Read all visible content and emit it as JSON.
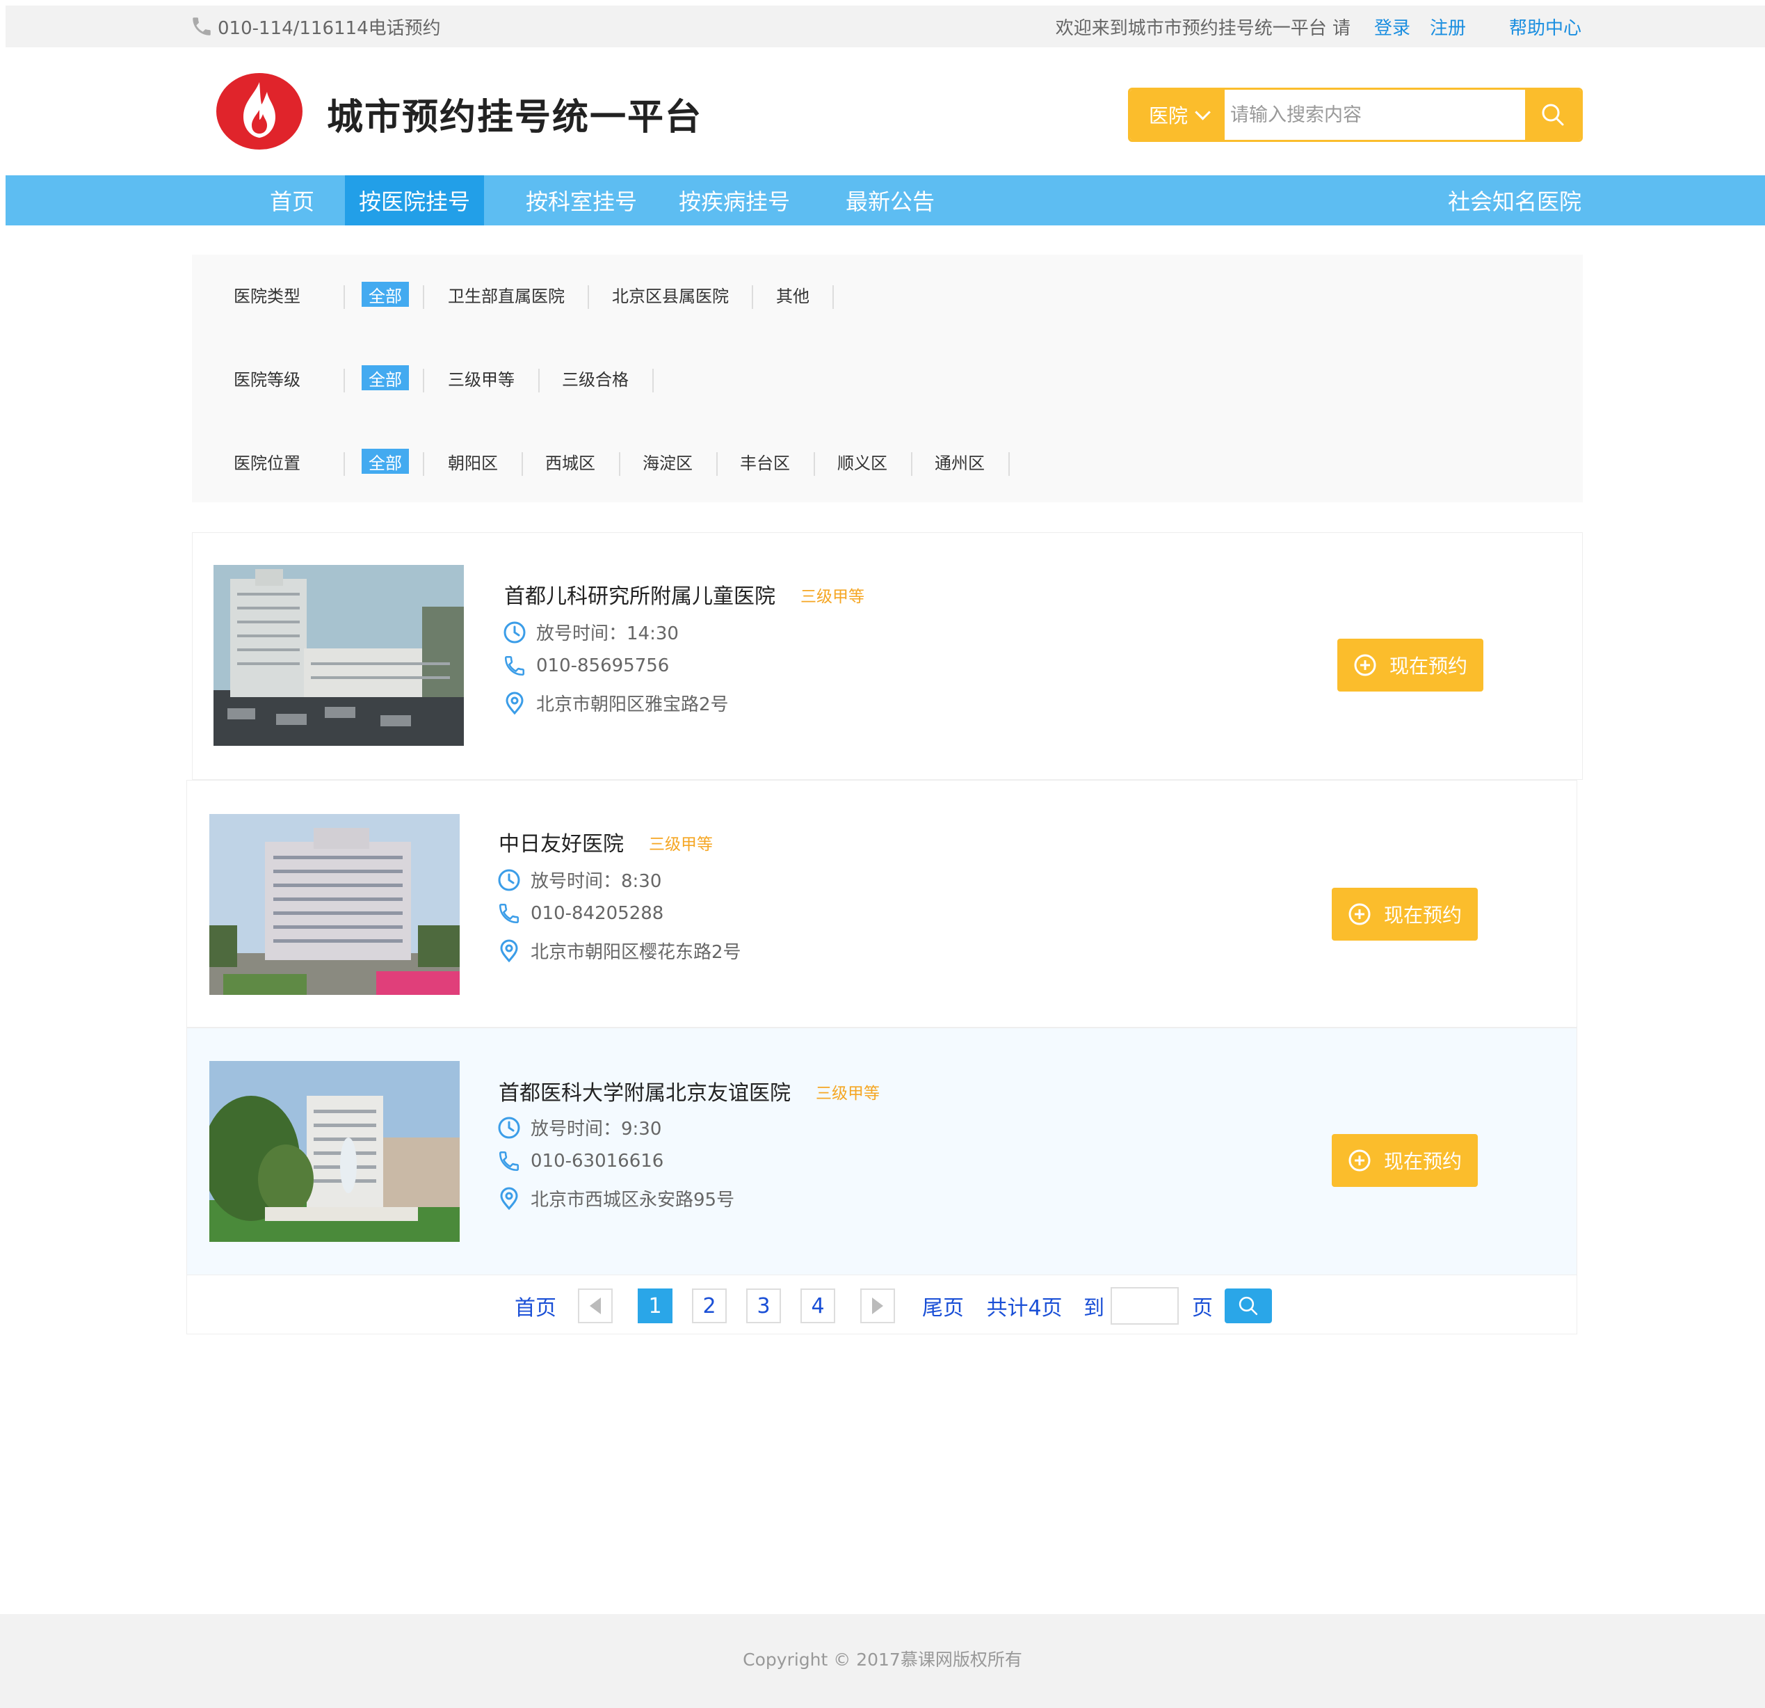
{
  "topbar": {
    "phone": "010-114/116114电话预约",
    "welcome": "欢迎来到城市市预约挂号统一平台 请",
    "login": "登录",
    "register": "注册",
    "help": "帮助中心"
  },
  "header": {
    "title": "城市预约挂号统一平台",
    "search_select": "医院",
    "search_placeholder": "请输入搜索内容"
  },
  "nav": {
    "items": [
      "首页",
      "按医院挂号",
      "按科室挂号",
      "按疾病挂号",
      "最新公告"
    ],
    "active": "按医院挂号",
    "right": "社会知名医院"
  },
  "filters": [
    {
      "label": "医院类型",
      "options": [
        "全部",
        "卫生部直属医院",
        "北京区县属医院",
        "其他"
      ],
      "selected": "全部"
    },
    {
      "label": "医院等级",
      "options": [
        "全部",
        "三级甲等",
        "三级合格"
      ],
      "selected": "全部"
    },
    {
      "label": "医院位置",
      "options": [
        "全部",
        "朝阳区",
        "西城区",
        "海淀区",
        "丰台区",
        "顺义区",
        "通州区"
      ],
      "selected": "全部"
    }
  ],
  "hospitals": [
    {
      "name": "首都儿科研究所附属儿童医院",
      "level": "三级甲等",
      "time": "放号时间：14:30",
      "phone": "010-85695756",
      "address": "北京市朝阳区雅宝路2号",
      "book": "现在预约"
    },
    {
      "name": "中日友好医院",
      "level": "三级甲等",
      "time": "放号时间：8:30",
      "phone": "010-84205288",
      "address": "北京市朝阳区樱花东路2号",
      "book": "现在预约"
    },
    {
      "name": "首都医科大学附属北京友谊医院",
      "level": "三级甲等",
      "time": "放号时间：9:30",
      "phone": "010-63016616",
      "address": "北京市西城区永安路95号",
      "book": "现在预约"
    }
  ],
  "pager": {
    "first": "首页",
    "pages": [
      "1",
      "2",
      "3",
      "4"
    ],
    "current": "1",
    "last": "尾页",
    "total": "共计4页",
    "goto": "到",
    "page_unit": "页"
  },
  "footer": {
    "copyright": "Copyright © 2017慕课网版权所有"
  },
  "colors": {
    "nav": "#5dbdf2",
    "nav_active": "#229fe8",
    "accent": "#fbbd2c",
    "link": "#1a8ee0",
    "level": "#f5a623"
  }
}
